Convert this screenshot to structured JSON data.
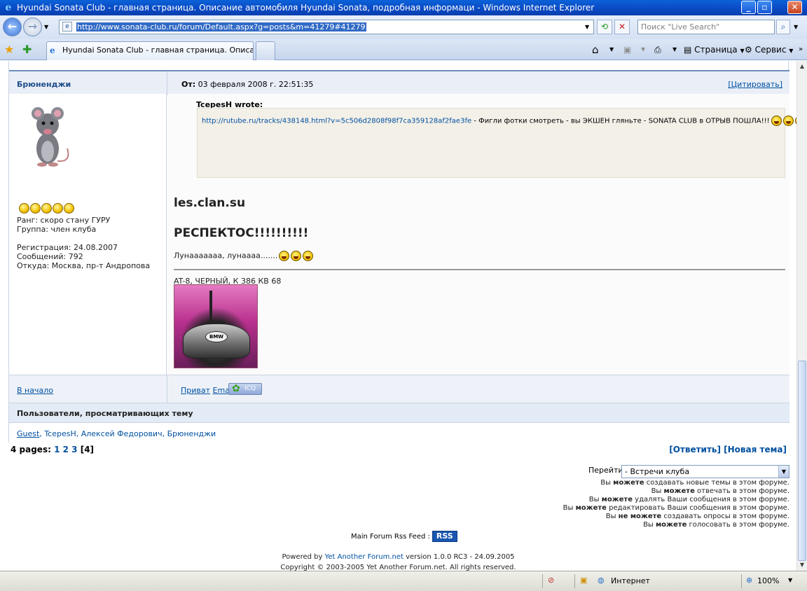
{
  "window": {
    "title": "Hyundai Sonata Club - главная страница. Описание автомобиля Hyundai Sonata, подробная информаци - Windows Internet Explorer"
  },
  "address": {
    "url": "http://www.sonata-club.ru/forum/Default.aspx?g=posts&m=41279#41279",
    "search_placeholder": "Поиск \"Live Search\""
  },
  "tabs": {
    "active_label": "Hyundai Sonata Club - главная страница. Описание..."
  },
  "toolbar": {
    "page_label": "Страница",
    "service_label": "Сервис"
  },
  "post": {
    "author": "Брюненджи",
    "from_label": "От:",
    "date": "03 февраля 2008 г. 22:51:35",
    "quote_link": "[Цитировать]",
    "user": {
      "rank": "Ранг: скоро стану ГУРУ",
      "group": "Группа: член клуба",
      "registered": "Регистрация: 24.08.2007",
      "messages": "Сообщений: 792",
      "location": "Откуда: Москва, пр-т Андропова",
      "stars": 5
    },
    "quote": {
      "wrote": "TcepesH wrote:",
      "link": "http://rutube.ru/tracks/438148.html?v=5c506d2808f98f7ca359128af2fae3fe",
      "text": " - Фигли фотки смотреть - вы ЭКШЕН гляньте - SONATA CLUB в ОТРЫВ ПОШЛА!!!"
    },
    "body_line1": "les.clan.su",
    "body_line2": "РЕСПЕКТОС!!!!!!!!!!",
    "body_line3": "Лунааааааа, лунаааа.......",
    "signature": "AT-8, ЧЕРНЫЙ, К 386 КВ 68",
    "sig_logo": "BMW"
  },
  "post_footer": {
    "to_start": "В начало",
    "privat": "Приват",
    "email": "Email",
    "icq": "ICQ"
  },
  "viewers": {
    "title": "Пользователи, просматривающих тему",
    "list": [
      "Guest",
      "TcepesH",
      "Алексей Федорович",
      "Брюненджи"
    ]
  },
  "pagination": {
    "label": "4 pages:",
    "pages": [
      "1",
      "2",
      "3"
    ],
    "current": "[4]",
    "reply": "[Ответить]",
    "new_topic": "[Новая тема]"
  },
  "goto": {
    "label": "Перейти",
    "selected": "- Встречи клуба"
  },
  "permissions": [
    {
      "pre": "Вы ",
      "bold": "можете",
      "post": " создавать новые темы в этом форуме."
    },
    {
      "pre": "Вы ",
      "bold": "можете",
      "post": " отвечать в этом форуме."
    },
    {
      "pre": "Вы ",
      "bold": "можете",
      "post": " удалять Ваши сообщения в этом форуме."
    },
    {
      "pre": "Вы ",
      "bold": "можете",
      "post": " редактировать Ваши сообщения в этом форуме."
    },
    {
      "pre": "Вы ",
      "bold": "не можете",
      "post": " создавать опросы в этом форуме."
    },
    {
      "pre": "Вы ",
      "bold": "можете",
      "post": " голосовать в этом форуме."
    }
  ],
  "footer": {
    "rss_label": "Main Forum Rss Feed :",
    "rss_button": "RSS",
    "powered_pre": "Powered by ",
    "powered_link": "Yet Another Forum.net",
    "powered_post": " version 1.0.0 RC3 - 24.09.2005",
    "copyright": "Copyright © 2003-2005 Yet Another Forum.net. All rights reserved."
  },
  "status": {
    "zone": "Интернет",
    "zoom": "100%"
  }
}
